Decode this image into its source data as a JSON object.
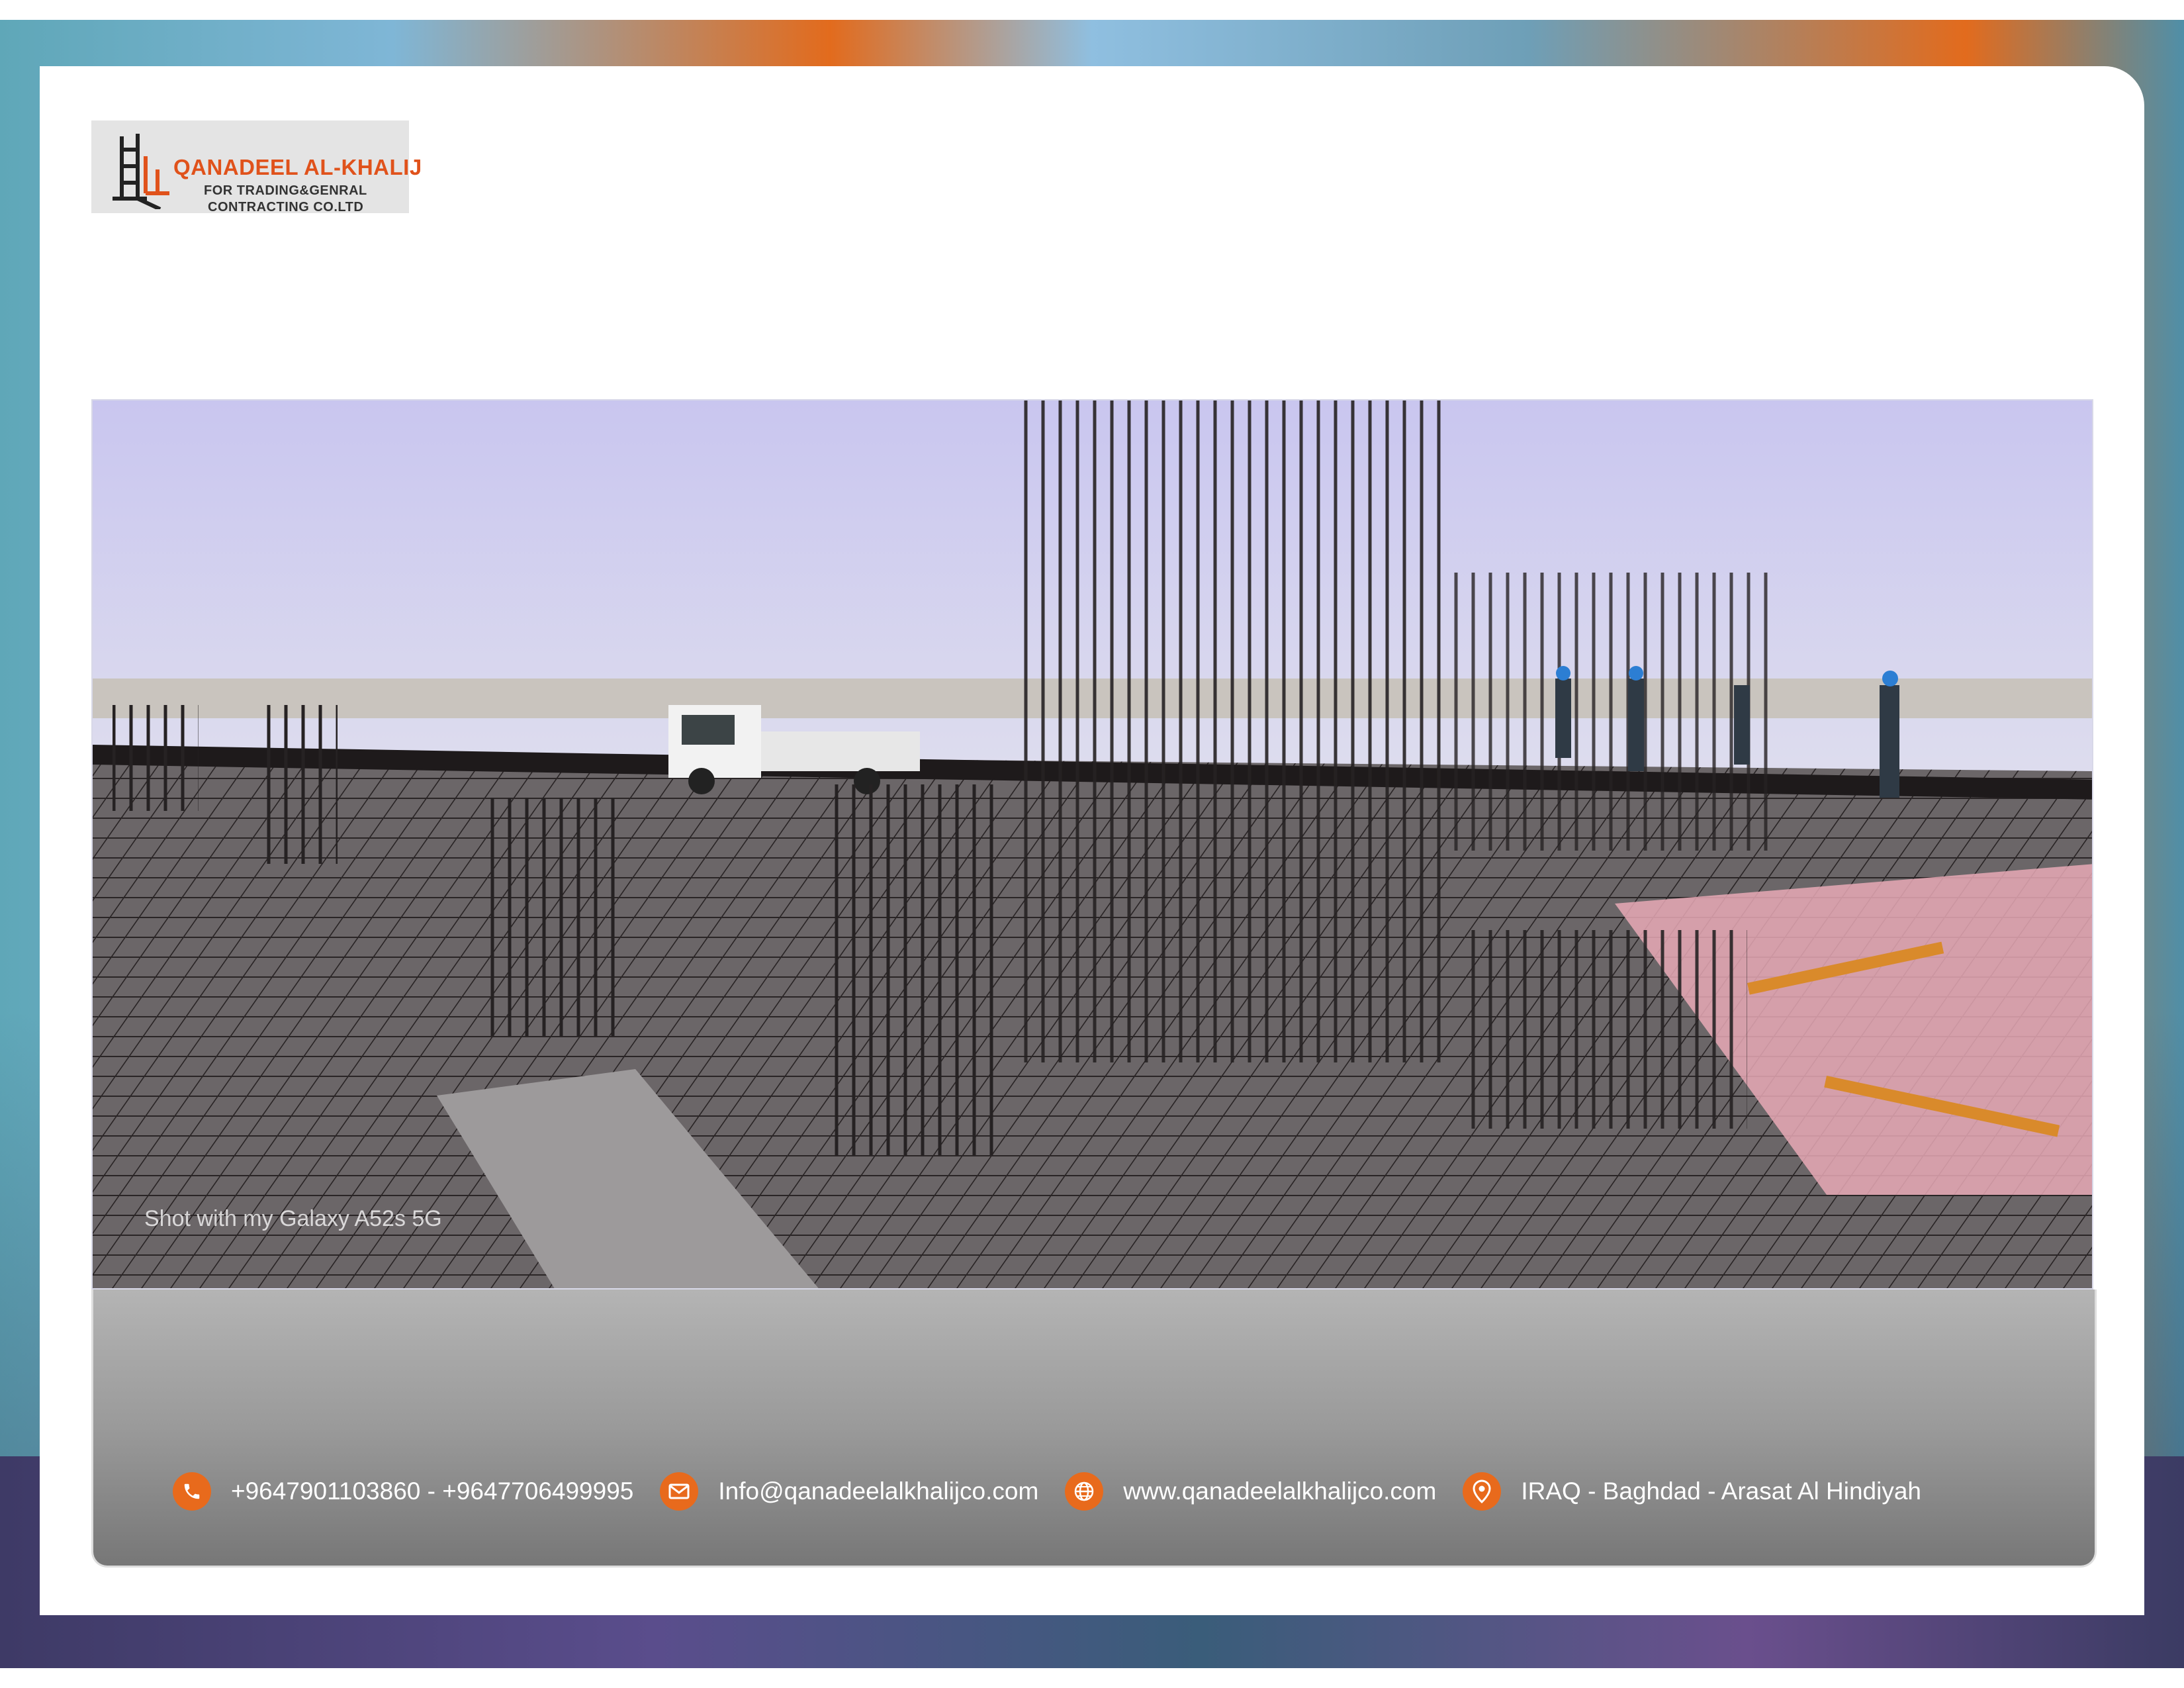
{
  "logo": {
    "name": "QANADEEL AL-KHALIJ",
    "subtitle_line1": "FOR TRADING&GENRAL",
    "subtitle_line2": "CONTRACTING CO.LTD"
  },
  "photo": {
    "description_icon": "construction-rebar-photo",
    "caption": "Shot with my Galaxy A52s 5G"
  },
  "contact": {
    "phone": "+9647901103860  -  +9647706499995",
    "email": "Info@qanadeelalkhalijco.com",
    "website": "www.qanadeelalkhalijco.com",
    "address": "IRAQ - Baghdad - Arasat Al Hindiyah",
    "icons": [
      "phone-icon",
      "mail-icon",
      "globe-icon",
      "location-pin-icon"
    ]
  },
  "colors": {
    "accent": "#e86a1c",
    "logo_text": "#e0521b"
  }
}
